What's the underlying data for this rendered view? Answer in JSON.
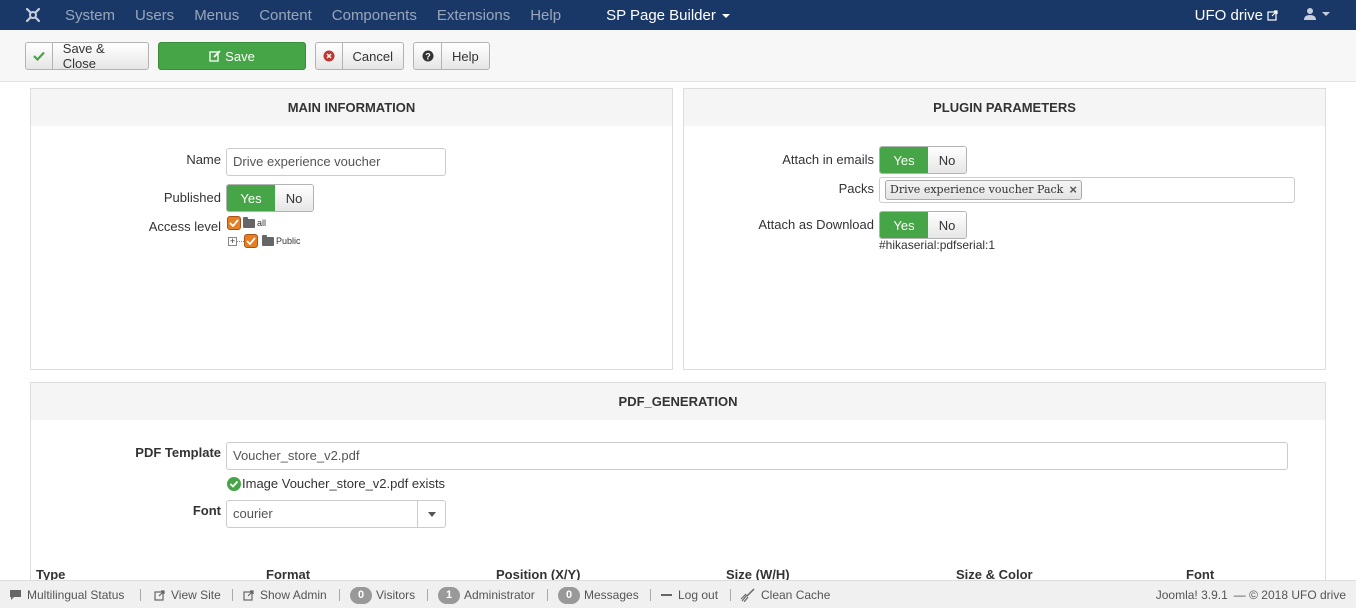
{
  "navbar": {
    "menu": [
      "System",
      "Users",
      "Menus",
      "Content",
      "Components",
      "Extensions",
      "Help"
    ],
    "active_menu": "SP Page Builder",
    "site_link": "UFO drive",
    "icons": {
      "logo": "joomla-logo-icon",
      "external": "external-link-icon",
      "user": "user-icon"
    }
  },
  "toolbar": {
    "save_close": "Save & Close",
    "save": "Save",
    "cancel": "Cancel",
    "help": "Help"
  },
  "main_info": {
    "title": "MAIN INFORMATION",
    "name_label": "Name",
    "name_value": "Drive experience voucher",
    "published_label": "Published",
    "yes": "Yes",
    "no": "No",
    "access_label": "Access level",
    "access_tree": [
      {
        "label": "all",
        "checked": true
      },
      {
        "label": "Public",
        "checked": true
      }
    ]
  },
  "plugin_params": {
    "title": "PLUGIN PARAMETERS",
    "attach_emails_label": "Attach in emails",
    "packs_label": "Packs",
    "pack_tag": "Drive experience voucher Pack",
    "attach_download_label": "Attach as Download",
    "yes": "Yes",
    "no": "No",
    "shortcode": "#hikaserial:pdfserial:1"
  },
  "pdf_generation": {
    "title": "PDF_GENERATION",
    "template_label": "PDF Template",
    "template_value": "Voucher_store_v2.pdf",
    "template_status": "Image Voucher_store_v2.pdf exists",
    "font_label": "Font",
    "font_value": "courier",
    "columns": [
      "Type",
      "Format",
      "Position (X/Y)",
      "Size (W/H)",
      "Size & Color",
      "Font"
    ]
  },
  "statusbar": {
    "multilingual": "Multilingual Status",
    "view_site": "View Site",
    "show_admin": "Show Admin",
    "visitors_count": "0",
    "visitors": "Visitors",
    "admin_count": "1",
    "administrator": "Administrator",
    "messages_count": "0",
    "messages": "Messages",
    "logout": "Log out",
    "clean_cache": "Clean Cache",
    "version": "Joomla! 3.9.1",
    "copyright": "— © 2018 UFO drive"
  },
  "colors": {
    "navbar": "#1a3867",
    "success": "#46a546",
    "danger": "#bd362f",
    "check": "#e67e22"
  }
}
